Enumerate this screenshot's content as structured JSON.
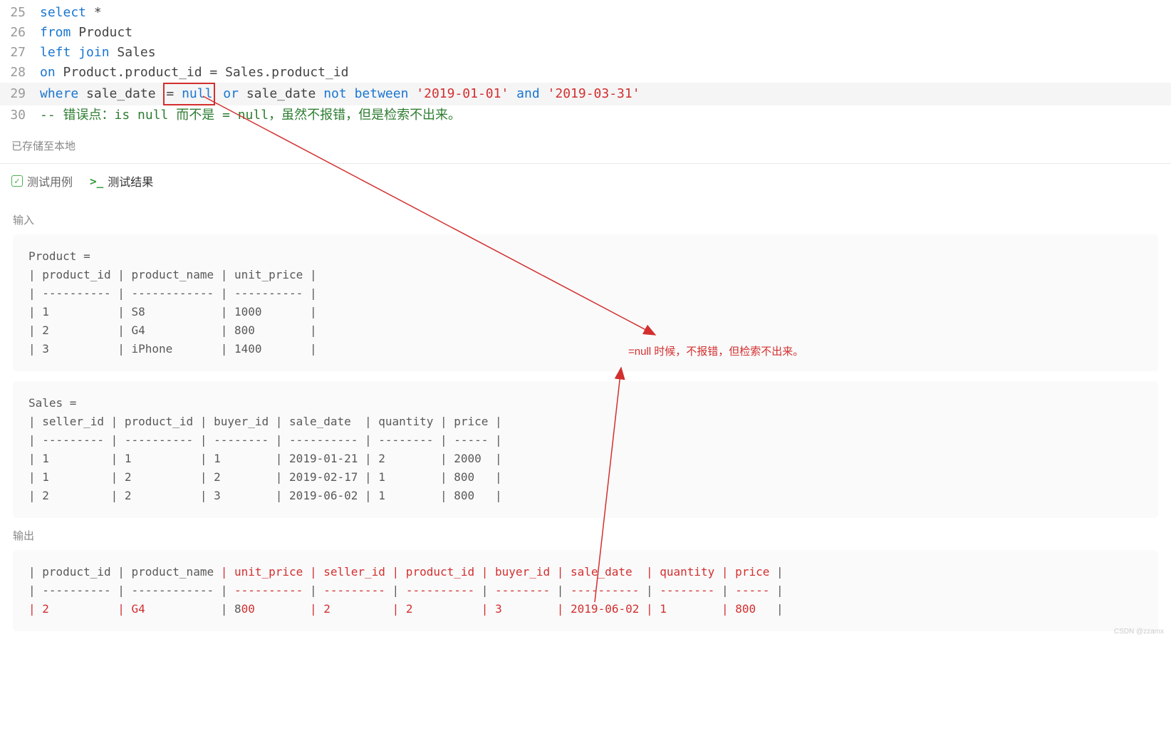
{
  "code": {
    "lines": [
      {
        "num": "25",
        "parts": [
          {
            "t": "select",
            "c": "kw"
          },
          {
            "t": " *",
            "c": "normal"
          }
        ]
      },
      {
        "num": "26",
        "parts": [
          {
            "t": "from",
            "c": "kw"
          },
          {
            "t": " Product",
            "c": "normal"
          }
        ]
      },
      {
        "num": "27",
        "parts": [
          {
            "t": "left",
            "c": "kw"
          },
          {
            "t": " ",
            "c": "normal"
          },
          {
            "t": "join",
            "c": "kw"
          },
          {
            "t": " Sales",
            "c": "normal"
          }
        ]
      },
      {
        "num": "28",
        "parts": [
          {
            "t": "on",
            "c": "kw"
          },
          {
            "t": " Product.product_id = Sales.product_id",
            "c": "normal"
          }
        ]
      },
      {
        "num": "29",
        "highlighted": true,
        "parts": [
          {
            "t": "where",
            "c": "kw"
          },
          {
            "t": " sale_date ",
            "c": "normal"
          },
          {
            "t": "= ",
            "c": "normal",
            "box": true
          },
          {
            "t": "null",
            "c": "kw",
            "box": true
          },
          {
            "t": " ",
            "c": "normal"
          },
          {
            "t": "or",
            "c": "kw"
          },
          {
            "t": " sale_date ",
            "c": "normal"
          },
          {
            "t": "not",
            "c": "kw"
          },
          {
            "t": " ",
            "c": "normal"
          },
          {
            "t": "between",
            "c": "kw"
          },
          {
            "t": " ",
            "c": "normal"
          },
          {
            "t": "'2019-01-01'",
            "c": "str"
          },
          {
            "t": " ",
            "c": "normal"
          },
          {
            "t": "and",
            "c": "kw"
          },
          {
            "t": " ",
            "c": "normal"
          },
          {
            "t": "'2019-03-31'",
            "c": "str"
          }
        ]
      },
      {
        "num": "30",
        "parts": [
          {
            "t": "-- 错误点：is null 而不是 = null，虽然不报错，但是检索不出来。",
            "c": "comment"
          }
        ]
      }
    ]
  },
  "status": "已存储至本地",
  "tabs": {
    "testcase": "测试用例",
    "result": "测试结果"
  },
  "labels": {
    "input": "输入",
    "output": "输出"
  },
  "input_blocks": [
    "Product =\n| product_id | product_name | unit_price |\n| ---------- | ------------ | ---------- |\n| 1          | S8           | 1000       |\n| 2          | G4           | 800        |\n| 3          | iPhone       | 1400       |",
    "Sales =\n| seller_id | product_id | buyer_id | sale_date  | quantity | price |\n| --------- | ---------- | -------- | ---------- | -------- | ----- |\n| 1         | 1          | 1        | 2019-01-21 | 2        | 2000  |\n| 1         | 2          | 2        | 2019-02-17 | 1        | 800   |\n| 2         | 2          | 3        | 2019-06-02 | 1        | 800   |"
  ],
  "output_header_black": "| product_id | product_name ",
  "output_header_red": "| unit_price | seller_id | product_id | buyer_id | sale_date  | quantity | price ",
  "output_header_end": "|",
  "output_divider_black": "| ---------- | ------------ | ",
  "output_divider_red": "---------- ",
  "output_divider_mid": "| ",
  "output_divider_red2": "--------- ",
  "output_divider_red3": "---------- ",
  "output_divider_red4": "-------- ",
  "output_divider_red5": "---------- ",
  "output_divider_red6": "-------- ",
  "output_divider_red7": "----- ",
  "output_divider_end": "|",
  "output_row_red1": "| 2          ",
  "output_row_red2": "| G4           ",
  "output_row_blk1": "| 8",
  "output_row_red3": "00        ",
  "output_row_red4": "| 2         ",
  "output_row_red5": "| 2          ",
  "output_row_red6": "| 3        ",
  "output_row_red7": "| 2019-06-02 ",
  "output_row_red8": "| 1        ",
  "output_row_red9": "| 800   ",
  "output_row_end": "|",
  "annotation": "=null 时候，不报错，但检索不出来。",
  "watermark": "CSDN @zzamx"
}
